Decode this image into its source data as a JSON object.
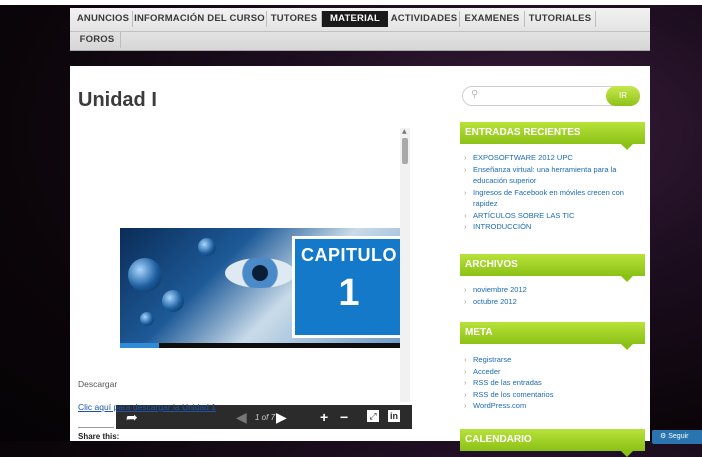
{
  "nav": {
    "items": [
      {
        "label": "ANUNCIOS"
      },
      {
        "label": "INFORMACIÓN DEL CURSO"
      },
      {
        "label": "TUTORES"
      },
      {
        "label": "MATERIAL"
      },
      {
        "label": "ACTIVIDADES"
      },
      {
        "label": "EXAMENES"
      },
      {
        "label": "TUTORIALES"
      },
      {
        "label": "FOROS"
      }
    ],
    "active": "MATERIAL"
  },
  "page": {
    "title": "Unidad I",
    "descargar_label": "Descargar",
    "download_link": "Clic aquí para descargar la Unidad 1",
    "share_label": "Share this:"
  },
  "slideshow": {
    "chapter_word": "CAPITULO",
    "chapter_number": "1",
    "page_counter": "1 of 7",
    "progress_fraction": 0.14,
    "icons": {
      "share": "share-arrow-icon",
      "prev": "play-left-icon",
      "next": "play-right-icon",
      "zoom_in": "plus-icon",
      "zoom_out": "minus-icon",
      "fullscreen": "expand-icon",
      "linkedin": "linkedin-icon"
    }
  },
  "search": {
    "placeholder": "",
    "button_label": "IR"
  },
  "widgets": {
    "recent_title": "ENTRADAS RECIENTES",
    "recent": [
      "EXPOSOFTWARE 2012 UPC",
      "Enseñanza virtual: una herramienta para la educación superior",
      "Ingresos de Facebook en móviles crecen con rapidez",
      "ARTÍCULOS SOBRE LAS TIC",
      "INTRODUCCIÓN"
    ],
    "archives_title": "ARCHIVOS",
    "archives": [
      "noviembre 2012",
      "octubre 2012"
    ],
    "meta_title": "META",
    "meta": [
      "Registrarse",
      "Acceder",
      "RSS de las entradas",
      "RSS de los comentarios",
      "WordPress.com"
    ],
    "calendar_title": "CALENDARIO"
  },
  "follow_label": "Seguir",
  "colors": {
    "accent_green": "#9fd12a",
    "nav_active_bg": "#1a1a1a",
    "link_blue": "#1a6bb5",
    "chapter_blue": "#1479c9"
  }
}
